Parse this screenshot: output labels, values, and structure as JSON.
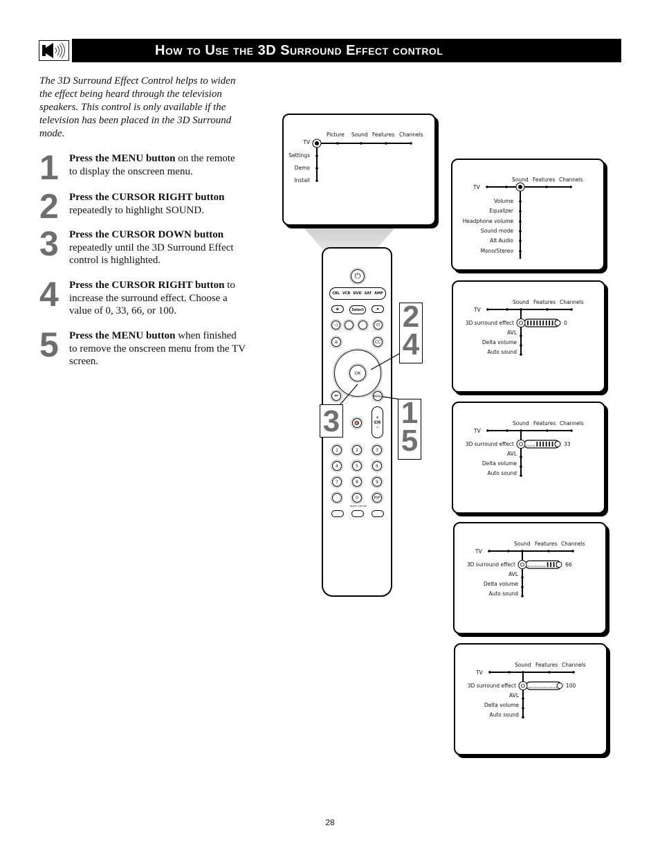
{
  "header": {
    "icon": "speaker-icon",
    "title": "How to Use the 3D Surround Effect control"
  },
  "intro": "The 3D Surround Effect Control helps to widen the effect being heard through the television speakers. This control is only available if the television has been placed in the 3D Surround mode.",
  "steps": [
    {
      "number": "1",
      "bold": "Press the MENU button",
      "text": " on the remote to display the onscreen menu."
    },
    {
      "number": "2",
      "bold": "Press the CURSOR RIGHT button",
      "text": " repeatedly to highlight SOUND."
    },
    {
      "number": "3",
      "bold": "Press the CURSOR DOWN button",
      "text": " repeatedly until the 3D Surround Effect control is highlighted."
    },
    {
      "number": "4",
      "bold": "Press the CURSOR RIGHT button",
      "text": " to increase the surround effect. Choose a value of 0, 33, 66, or 100."
    },
    {
      "number": "5",
      "bold": "Press the MENU button",
      "text": " when finished to remove the onscreen menu from the TV screen."
    }
  ],
  "screens": {
    "main_menu": {
      "root": "TV",
      "top_items": [
        "Picture",
        "Sound",
        "Features",
        "Channels"
      ],
      "side_items": [
        "Settings",
        "Demo",
        "Install"
      ]
    },
    "sound_menu": {
      "root": "TV",
      "top_items": [
        "Sound",
        "Features",
        "Channels"
      ],
      "side_items": [
        "Volume",
        "Equalizer",
        "Headphone volume",
        "Sound mode",
        "Alt Audio",
        "Mono/Stereo"
      ]
    },
    "surround_screens": [
      {
        "root": "TV",
        "top_items": [
          "Sound",
          "Features",
          "Channels"
        ],
        "selected": "3D surround effect",
        "side_items": [
          "AVL",
          "Delta volume",
          "Auto sound"
        ],
        "value": "0",
        "level_percent": 0
      },
      {
        "root": "TV",
        "top_items": [
          "Sound",
          "Features",
          "Channels"
        ],
        "selected": "3D surround effect",
        "side_items": [
          "AVL",
          "Delta volume",
          "Auto sound"
        ],
        "value": "33",
        "level_percent": 33
      },
      {
        "root": "TV",
        "top_items": [
          "Sound",
          "Features",
          "Channels"
        ],
        "selected": "3D surround effect",
        "side_items": [
          "AVL",
          "Delta volume",
          "Auto sound"
        ],
        "value": "66",
        "level_percent": 66
      },
      {
        "root": "TV",
        "top_items": [
          "Sound",
          "Features",
          "Channels"
        ],
        "selected": "3D surround effect",
        "side_items": [
          "AVL",
          "Delta volume",
          "Auto sound"
        ],
        "value": "100",
        "level_percent": 100
      }
    ]
  },
  "remote": {
    "source_buttons": [
      "CBL",
      "VCR",
      "DVD",
      "SAT",
      "AMP"
    ],
    "select_label": "Select",
    "ok_label": "OK",
    "cc_label": "CC",
    "menu_label": "MENU",
    "ch_label": "CH",
    "ch_plus": "+",
    "ch_minus": "–",
    "digits": [
      "1",
      "2",
      "3",
      "4",
      "5",
      "6",
      "7",
      "8",
      "9",
      "0"
    ],
    "pip_label": "PIP",
    "active_control_label": "Active Control"
  },
  "callouts": [
    {
      "id": "callout-2-4",
      "lines": [
        "2",
        "4"
      ]
    },
    {
      "id": "callout-3",
      "lines": [
        "3"
      ]
    },
    {
      "id": "callout-1-5",
      "lines": [
        "1",
        "5"
      ]
    }
  ],
  "page_number": "28"
}
